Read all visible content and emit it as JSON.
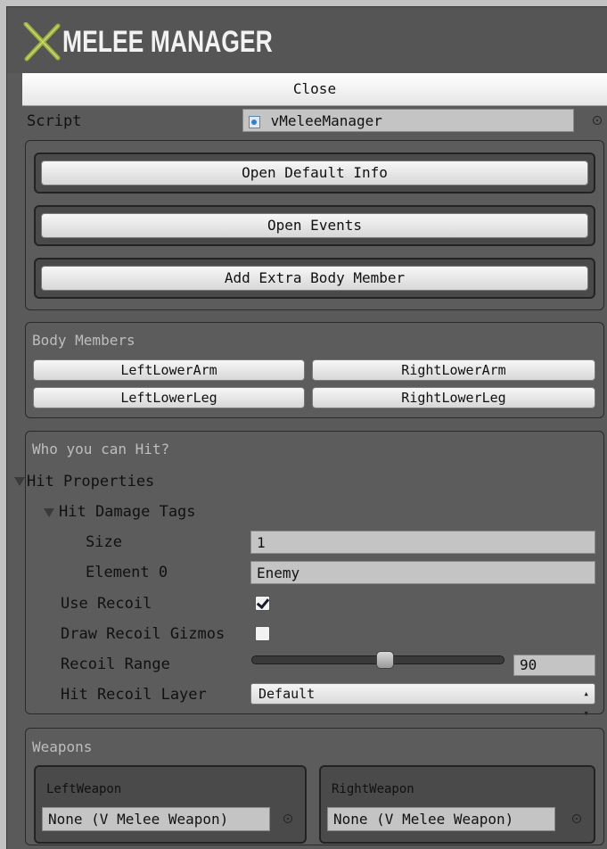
{
  "header": {
    "title": "MELEE MANAGER",
    "close_label": "Close"
  },
  "script": {
    "label": "Script",
    "value": "vMeleeManager",
    "icon": "csharp-script-icon"
  },
  "buttons": {
    "open_default_info": "Open Default Info",
    "open_events": "Open Events",
    "add_extra_body_member": "Add Extra Body Member"
  },
  "body_members": {
    "title": "Body Members",
    "items": [
      "LeftLowerArm",
      "RightLowerArm",
      "LeftLowerLeg",
      "RightLowerLeg"
    ]
  },
  "hit": {
    "title": "Who you can Hit?",
    "hit_properties_label": "Hit Properties",
    "hit_damage_tags_label": "Hit Damage Tags",
    "size_label": "Size",
    "size_value": "1",
    "element0_label": "Element 0",
    "element0_value": "Enemy",
    "use_recoil_label": "Use Recoil",
    "use_recoil_checked": true,
    "draw_recoil_gizmos_label": "Draw Recoil Gizmos",
    "draw_recoil_gizmos_checked": false,
    "recoil_range_label": "Recoil Range",
    "recoil_range_value": "90",
    "recoil_range_fraction": 0.53,
    "hit_recoil_layer_label": "Hit Recoil Layer",
    "hit_recoil_layer_value": "Default"
  },
  "weapons": {
    "title": "Weapons",
    "left_label": "LeftWeapon",
    "left_value": "None (V Melee Weapon)",
    "right_label": "RightWeapon",
    "right_value": "None (V Melee Weapon)"
  },
  "colors": {
    "logo_green": "#8fa23a",
    "panel": "#5a5a5a",
    "background": "#c2c2c2"
  }
}
